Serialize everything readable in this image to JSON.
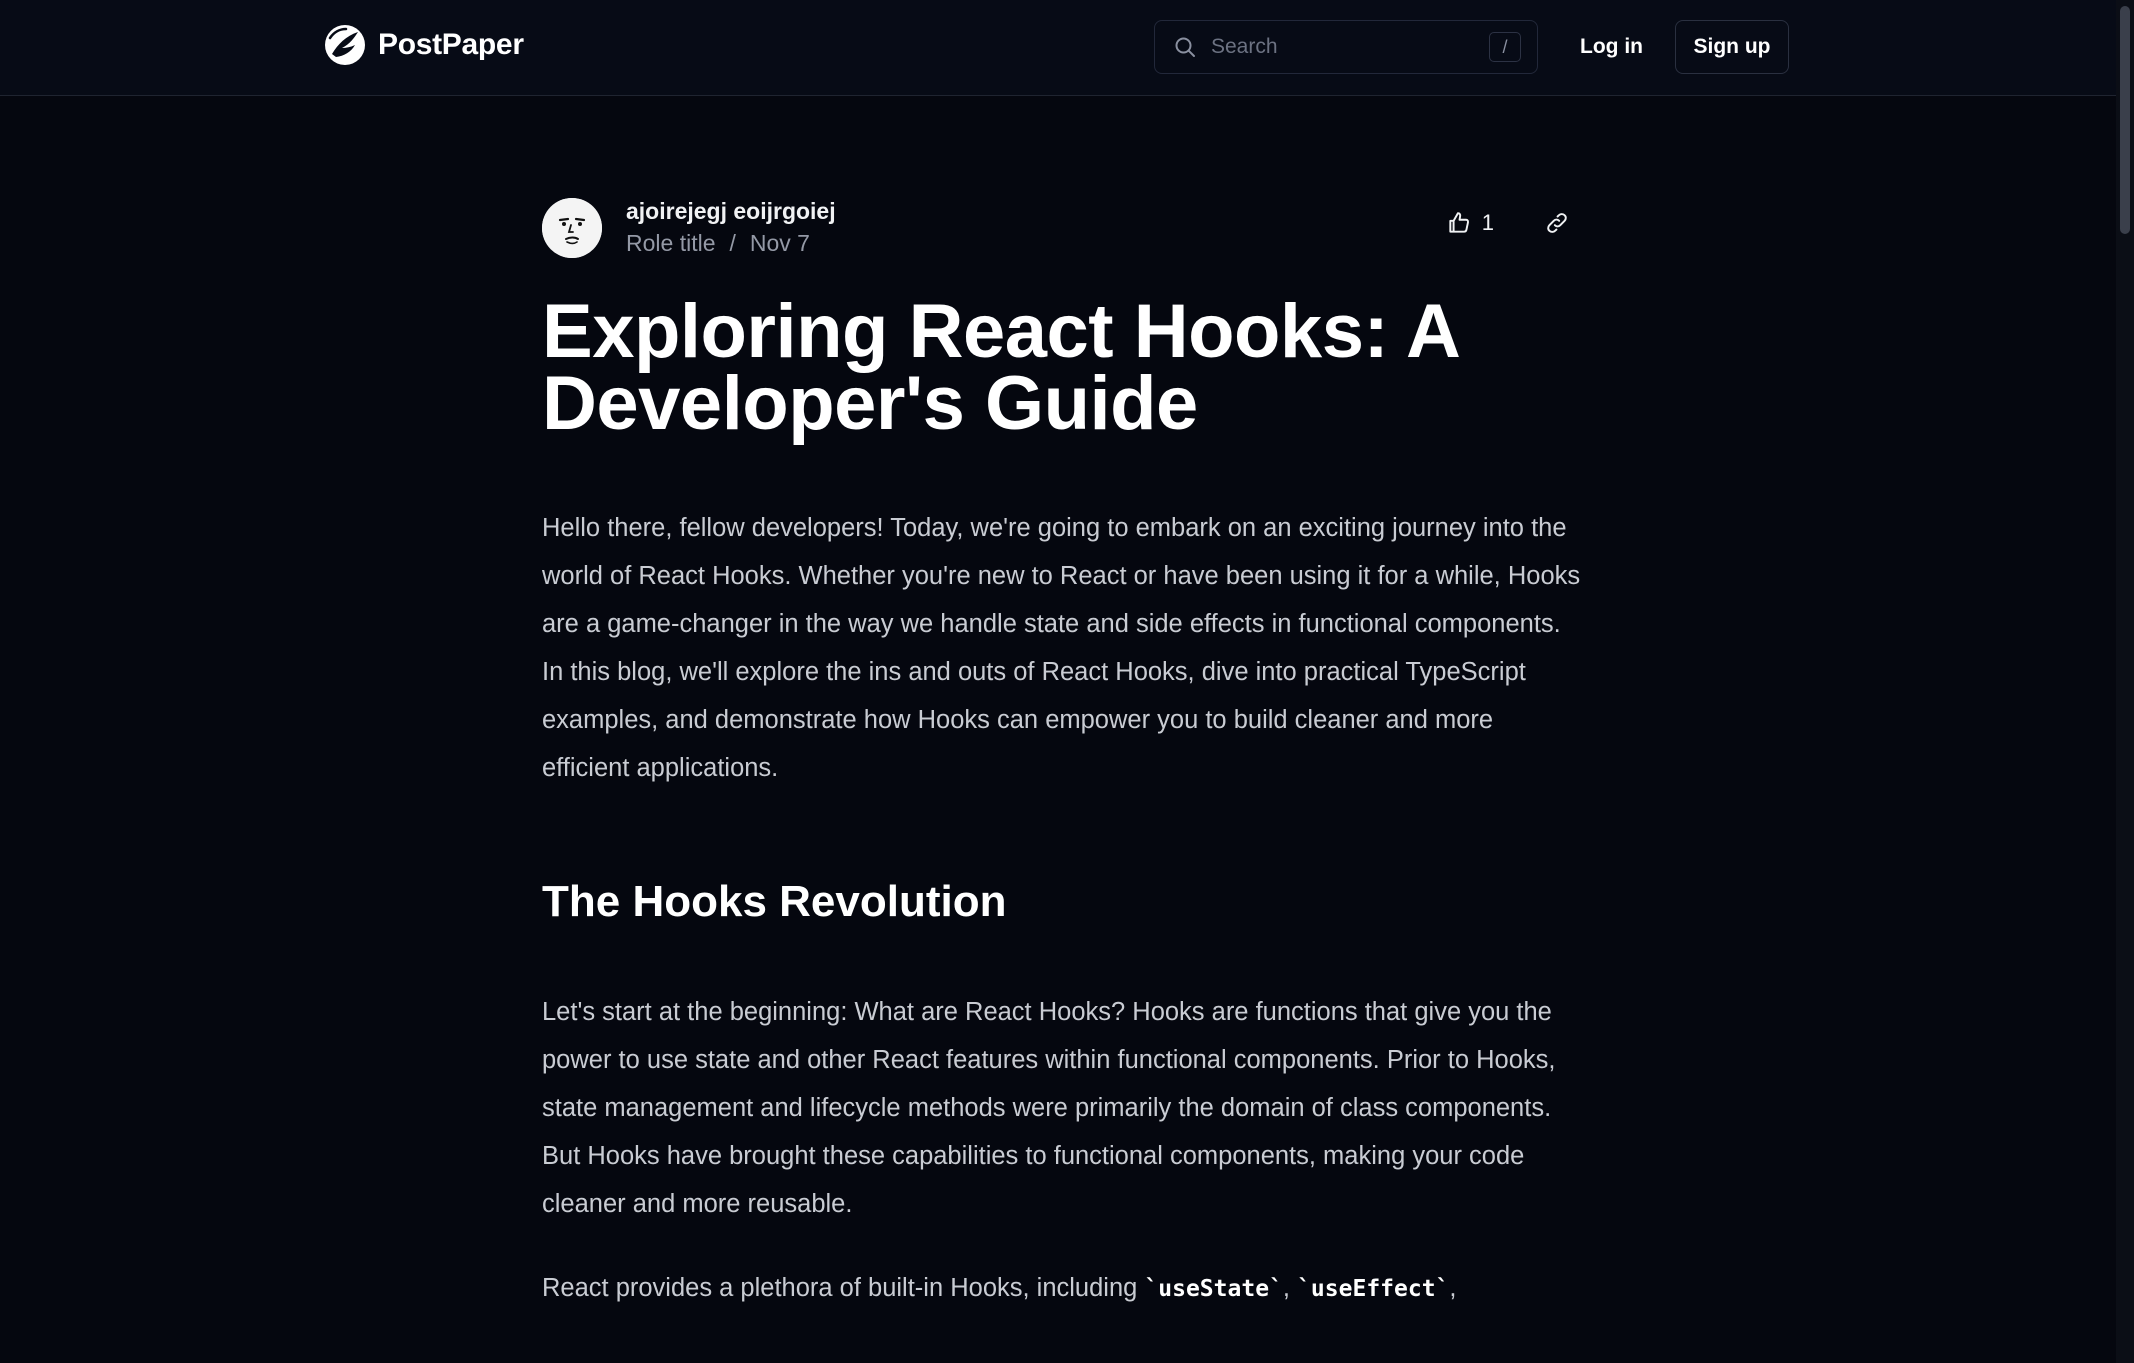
{
  "header": {
    "brand_name": "PostPaper",
    "search_placeholder": "Search",
    "search_shortcut": "/",
    "login_label": "Log in",
    "signup_label": "Sign up"
  },
  "article": {
    "author_name": "ajoirejegj eoijrgoiej",
    "role": "Role title",
    "separator": "/",
    "date": "Nov 7",
    "like_count": "1",
    "title": "Exploring React Hooks: A Developer's Guide",
    "intro": "Hello there, fellow developers! Today, we're going to embark on an exciting journey into the world of React Hooks. Whether you're new to React or have been using it for a while, Hooks are a game-changer in the way we handle state and side effects in functional components. In this blog, we'll explore the ins and outs of React Hooks, dive into practical TypeScript examples, and demonstrate how Hooks can empower you to build cleaner and more efficient applications.",
    "section_heading": "The Hooks Revolution",
    "section_paragraph": "Let's start at the beginning: What are React Hooks? Hooks are functions that give you the power to use state and other React features within functional components. Prior to Hooks, state management and lifecycle methods were primarily the domain of class components. But Hooks have brought these capabilities to functional components, making your code cleaner and more reusable.",
    "next_paragraph_prefix": "React provides a plethora of built-in Hooks, including ",
    "code_use_state": "`useState`",
    "comma_1": ", ",
    "code_use_effect": "`useEffect`",
    "comma_2": ","
  },
  "colors": {
    "background": "#05070f",
    "header_background": "#070b16",
    "text_primary": "#ffffff",
    "text_body": "#c9ccd3",
    "text_muted": "#9499a6"
  },
  "icons": {
    "brand": "postpaper-logo-icon",
    "search": "search-icon",
    "like": "thumbs-up-icon",
    "link": "link-icon"
  }
}
